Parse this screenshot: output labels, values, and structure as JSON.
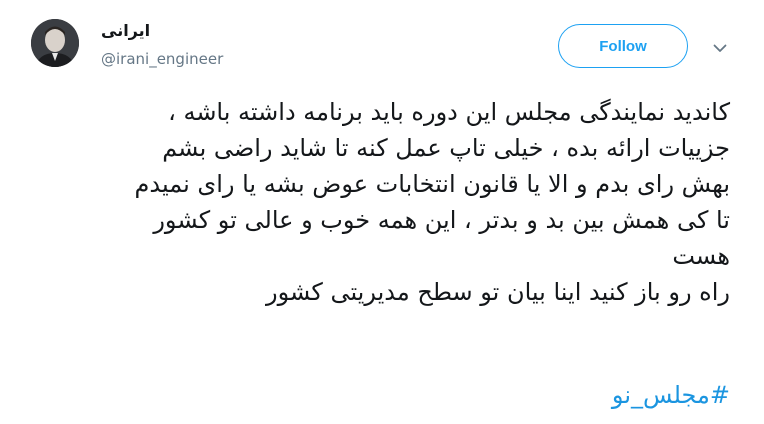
{
  "user": {
    "display_name": "ایرانی",
    "handle": "@irani_engineer",
    "avatar_icon": "profile-photo"
  },
  "actions": {
    "follow_label": "Follow",
    "more_icon": "chevron-down-icon"
  },
  "tweet": {
    "lines": [
      "کاندید نمایندگی مجلس این دوره باید برنامه داشته باشه ،",
      "جزییات ارائه بده ، خیلی تاپ عمل کنه تا شاید راضی بشم",
      "بهش رای بدم و الا یا قانون انتخابات عوض بشه یا رای نمیدم",
      "تا کی همش بین بد و بدتر ، این همه خوب و عالی تو کشور",
      "هست",
      "راه رو باز کنید اینا بیان تو سطح مدیریتی کشور"
    ],
    "hashtag": "#مجلس_نو"
  },
  "colors": {
    "accent": "#1da1f2",
    "link": "#1b95e0",
    "text": "#14171a",
    "secondary": "#657786"
  }
}
